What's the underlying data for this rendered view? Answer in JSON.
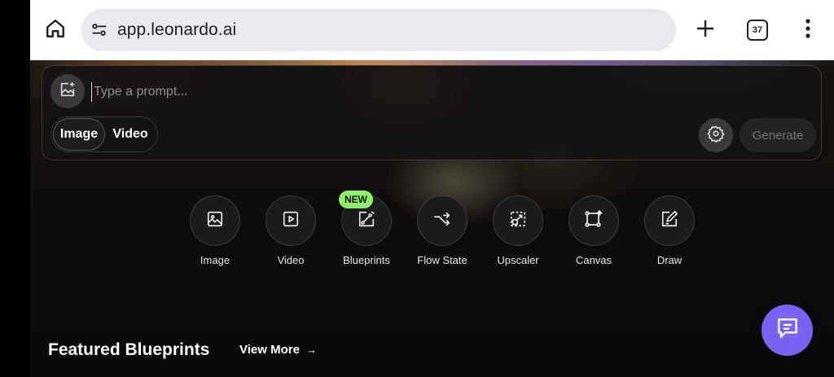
{
  "browser": {
    "url": "app.leonardo.ai",
    "tab_count": "37",
    "icons": [
      "home-icon",
      "site-settings-icon",
      "plus-icon",
      "tabs-icon",
      "more-vert-icon"
    ]
  },
  "prompt": {
    "placeholder": "Type a prompt...",
    "modes": [
      "Image",
      "Video"
    ],
    "active_mode": "Image",
    "generate_label": "Generate"
  },
  "quick_actions": {
    "items": [
      {
        "label": "Image",
        "icon": "image-icon"
      },
      {
        "label": "Video",
        "icon": "video-icon"
      },
      {
        "label": "Blueprints",
        "icon": "blueprints-icon",
        "badge": "NEW"
      },
      {
        "label": "Flow State",
        "icon": "flow-state-icon"
      },
      {
        "label": "Upscaler",
        "icon": "upscaler-icon"
      },
      {
        "label": "Canvas",
        "icon": "canvas-icon"
      },
      {
        "label": "Draw",
        "icon": "draw-icon"
      }
    ]
  },
  "featured": {
    "title": "Featured Blueprints",
    "view_more": "View More",
    "arrow": "→"
  },
  "colors": {
    "accent_purple": "#7a63f2",
    "badge_green": "#8cf06a",
    "background": "#0a0a0b"
  }
}
